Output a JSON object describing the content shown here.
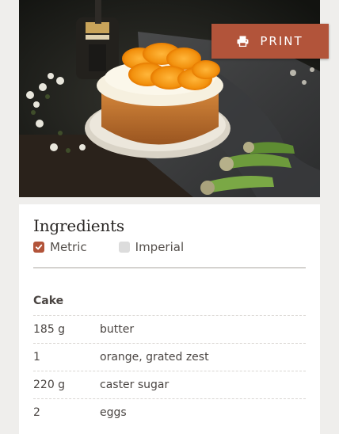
{
  "print_button": {
    "label": "PRINT",
    "icon": "printer-icon",
    "color": "#b2543a"
  },
  "ingredients": {
    "title": "Ingredients",
    "units": [
      {
        "label": "Metric",
        "checked": true
      },
      {
        "label": "Imperial",
        "checked": false
      }
    ],
    "sections": [
      {
        "heading": "Cake",
        "items": [
          {
            "qty": "185 g",
            "name": "butter"
          },
          {
            "qty": "1",
            "name": "orange, grated zest"
          },
          {
            "qty": "220 g",
            "name": "caster sugar"
          },
          {
            "qty": "2",
            "name": "eggs"
          }
        ]
      }
    ]
  },
  "colors": {
    "accent": "#b2543a",
    "page_background": "#efeeec",
    "card_background": "#ffffff"
  }
}
